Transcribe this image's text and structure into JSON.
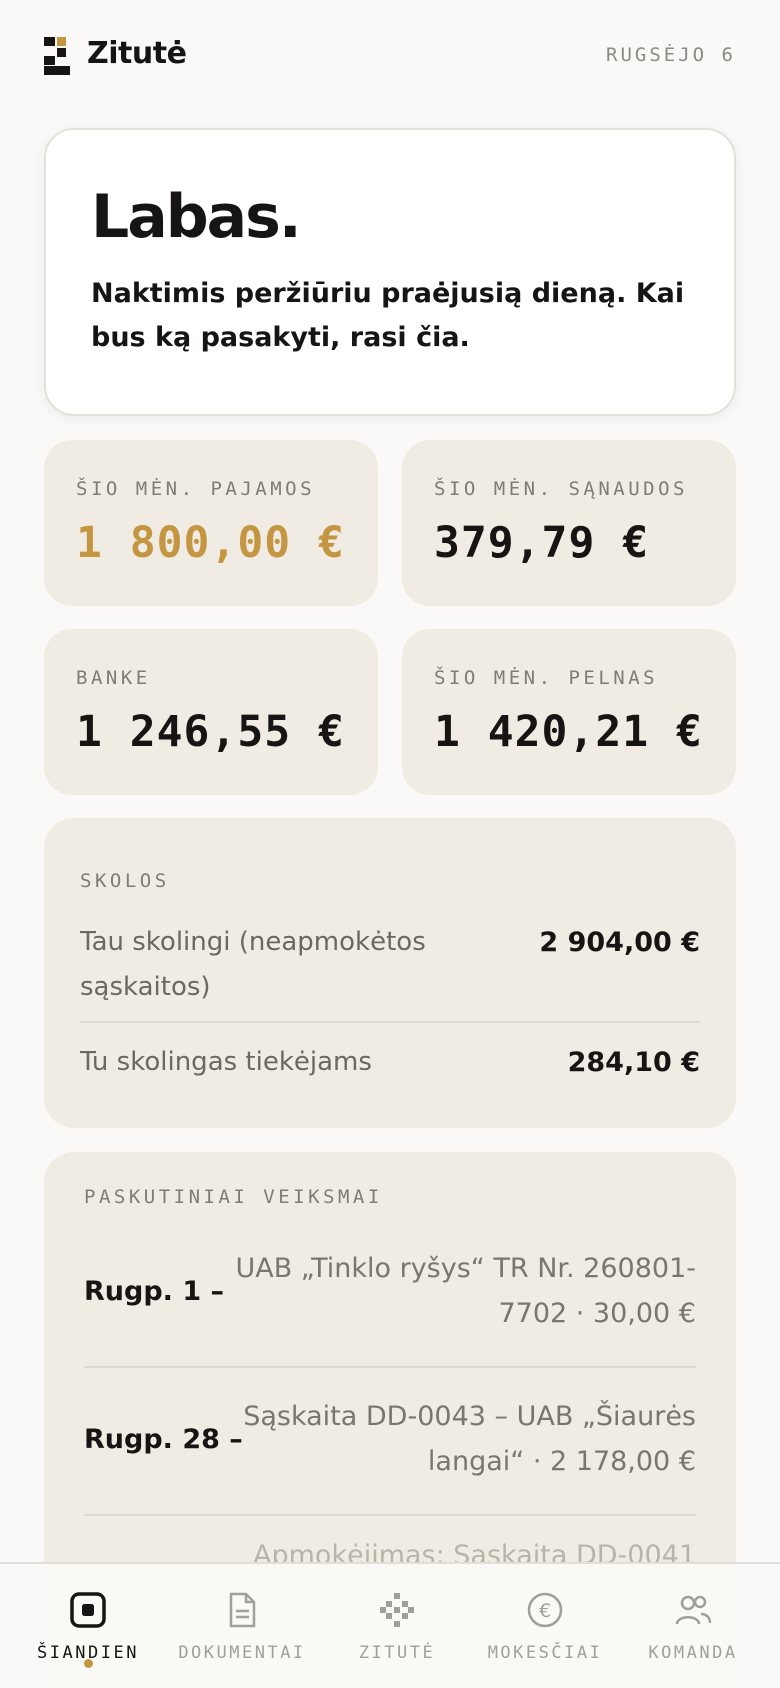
{
  "header": {
    "brand": "Zitutė",
    "date": "RUGSĖJO 6"
  },
  "greeting": {
    "title": "Labas.",
    "text": "Naktimis peržiūriu praėjusią dieną. Kai bus ką pasakyti, rasi čia."
  },
  "stats": [
    {
      "label": "ŠIO MĖN. PAJAMOS",
      "value": "1 800,00 €"
    },
    {
      "label": "ŠIO MĖN. SĄNAUDOS",
      "value": "379,79 €"
    },
    {
      "label": "BANKE",
      "value": "1 246,55 €"
    },
    {
      "label": "ŠIO MĖN. PELNAS",
      "value": "1 420,21 €"
    }
  ],
  "debts": {
    "title": "SKOLOS",
    "rows": [
      {
        "label": "Tau skolingi (neapmokėtos sąskaitos)",
        "amount": "2 904,00 €"
      },
      {
        "label": "Tu skolingas tiekėjams",
        "amount": "284,10 €"
      }
    ]
  },
  "recent": {
    "title": "PASKUTINIAI VEIKSMAI",
    "items": [
      {
        "date": "Rugp. 1 –",
        "desc": "UAB „Tinklo ryšys“ TR Nr. 260801-7702 · 30,00 €"
      },
      {
        "date": "Rugp. 28 –",
        "desc": "Sąskaita DD-0043 – UAB „Šiaurės langai“ · 2 178,00 €"
      },
      {
        "date": "",
        "desc": "Apmokėjimas: Sąskaita DD-0041"
      }
    ]
  },
  "nav": {
    "items": [
      {
        "label": "ŠIANDIEN",
        "icon": "today-icon",
        "active": true
      },
      {
        "label": "DOKUMENTAI",
        "icon": "document-icon",
        "active": false
      },
      {
        "label": "ZITUTĖ",
        "icon": "assistant-grid-icon",
        "active": false
      },
      {
        "label": "MOKESČIAI",
        "icon": "euro-icon",
        "active": false
      },
      {
        "label": "KOMANDA",
        "icon": "team-icon",
        "active": false
      }
    ]
  },
  "colors": {
    "accent": "#c49642",
    "card": "#f0ece3",
    "background": "#faf9f7",
    "text": "#161513"
  }
}
